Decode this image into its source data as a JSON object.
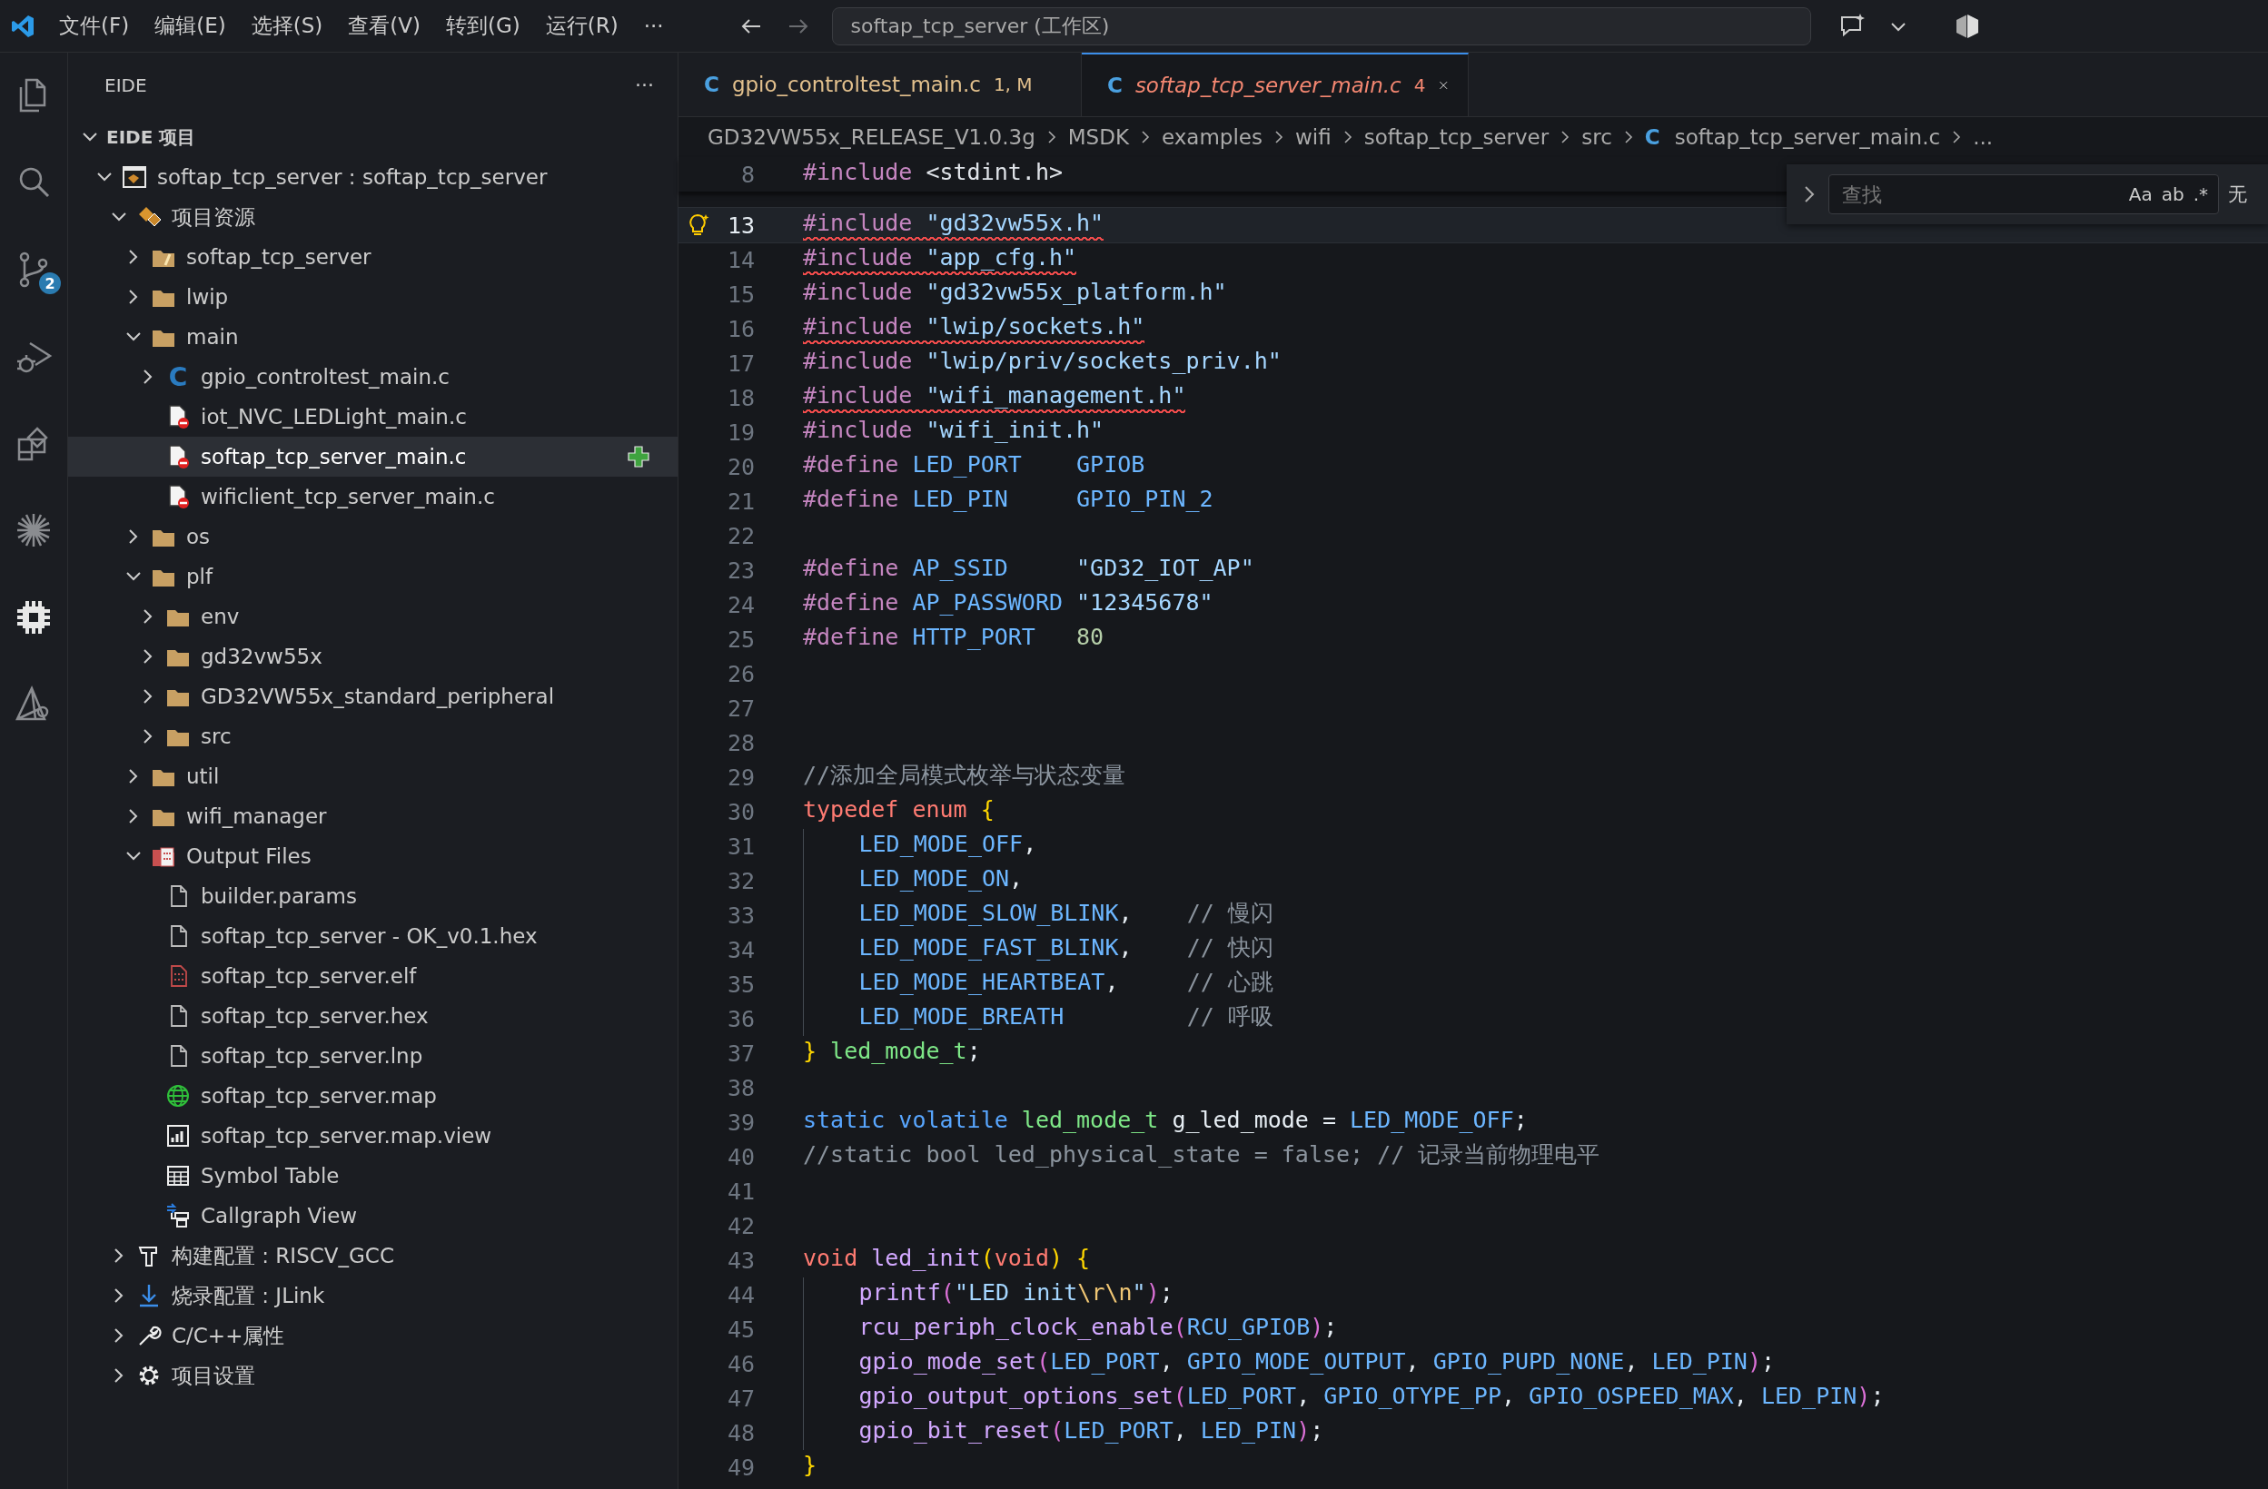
{
  "menubar": {
    "menus": [
      "文件(F)",
      "编辑(E)",
      "选择(S)",
      "查看(V)",
      "转到(G)",
      "运行(R)"
    ],
    "overflow": "···",
    "command_center": "softap_tcp_server (工作区)"
  },
  "activity_bar": [
    {
      "kind": "files",
      "selected": false
    },
    {
      "kind": "search",
      "selected": false
    },
    {
      "kind": "source-control",
      "selected": false,
      "badge": "2"
    },
    {
      "kind": "run-debug",
      "selected": false
    },
    {
      "kind": "extensions",
      "selected": false
    },
    {
      "kind": "starburst",
      "selected": false
    },
    {
      "kind": "chip",
      "selected": true
    },
    {
      "kind": "triangle-tool",
      "selected": false
    }
  ],
  "sidebar": {
    "title": "EIDE",
    "more": "···",
    "tree": [
      {
        "label": "EIDE 项目",
        "kind": "section",
        "expanded": true,
        "selected": false,
        "children": [
          {
            "label": "softap_tcp_server : softap_tcp_server",
            "kind": "project",
            "expanded": true,
            "selected": false,
            "children": [
              {
                "label": "项目资源",
                "kind": "resources",
                "expanded": true,
                "selected": false,
                "children": [
                  {
                    "label": "softap_tcp_server",
                    "kind": "folder-link",
                    "expanded": false,
                    "selected": false
                  },
                  {
                    "label": "lwip",
                    "kind": "folder",
                    "expanded": false,
                    "selected": false
                  },
                  {
                    "label": "main",
                    "kind": "folder",
                    "expanded": true,
                    "selected": false,
                    "children": [
                      {
                        "label": "gpio_controltest_main.c",
                        "kind": "c-file",
                        "icon_text": "C",
                        "expanded": false,
                        "selected": false
                      },
                      {
                        "label": "iot_NVC_LEDLight_main.c",
                        "kind": "excluded-file",
                        "selected": false
                      },
                      {
                        "label": "softap_tcp_server_main.c",
                        "kind": "excluded-file",
                        "selected": true
                      },
                      {
                        "label": "wificlient_tcp_server_main.c",
                        "kind": "excluded-file",
                        "selected": false
                      }
                    ]
                  },
                  {
                    "label": "os",
                    "kind": "folder",
                    "expanded": false,
                    "selected": false
                  },
                  {
                    "label": "plf",
                    "kind": "folder",
                    "expanded": true,
                    "selected": false,
                    "children": [
                      {
                        "label": "env",
                        "kind": "folder",
                        "expanded": false,
                        "selected": false
                      },
                      {
                        "label": "gd32vw55x",
                        "kind": "folder",
                        "expanded": false,
                        "selected": false
                      },
                      {
                        "label": "GD32VW55x_standard_peripheral",
                        "kind": "folder",
                        "expanded": false,
                        "selected": false
                      },
                      {
                        "label": "src",
                        "kind": "folder",
                        "expanded": false,
                        "selected": false
                      }
                    ]
                  },
                  {
                    "label": "util",
                    "kind": "folder",
                    "expanded": false,
                    "selected": false
                  },
                  {
                    "label": "wifi_manager",
                    "kind": "folder",
                    "expanded": false,
                    "selected": false
                  },
                  {
                    "label": "Output Files",
                    "kind": "binary-folder",
                    "expanded": true,
                    "selected": false,
                    "children": [
                      {
                        "label": "builder.params",
                        "kind": "file",
                        "selected": false
                      },
                      {
                        "label": "softap_tcp_server - OK_v0.1.hex",
                        "kind": "file",
                        "selected": false
                      },
                      {
                        "label": "softap_tcp_server.elf",
                        "kind": "binary-file",
                        "selected": false
                      },
                      {
                        "label": "softap_tcp_server.hex",
                        "kind": "file",
                        "selected": false
                      },
                      {
                        "label": "softap_tcp_server.lnp",
                        "kind": "file",
                        "selected": false
                      },
                      {
                        "label": "softap_tcp_server.map",
                        "kind": "globe",
                        "selected": false
                      },
                      {
                        "label": "softap_tcp_server.map.view",
                        "kind": "chart",
                        "selected": false
                      },
                      {
                        "label": "Symbol Table",
                        "kind": "table",
                        "selected": false
                      },
                      {
                        "label": "Callgraph View",
                        "kind": "callgraph",
                        "selected": false
                      }
                    ]
                  }
                ]
              },
              {
                "label": "构建配置 : RISCV_GCC",
                "kind": "hammer",
                "expanded": false,
                "selected": false
              },
              {
                "label": "烧录配置 : JLink",
                "kind": "download",
                "expanded": false,
                "selected": false
              },
              {
                "label": "C/C++属性",
                "kind": "wrench",
                "expanded": false,
                "selected": false
              },
              {
                "label": "项目设置",
                "kind": "gear",
                "expanded": false,
                "selected": false
              }
            ]
          }
        ]
      }
    ]
  },
  "tabs": [
    {
      "icon_text": "C",
      "label": "gpio_controltest_main.c",
      "status": "1, M",
      "color": "#e2c08d",
      "preview": false,
      "selected": false
    },
    {
      "icon_text": "C",
      "label": "softap_tcp_server_main.c",
      "status": "4",
      "color": "#f48771",
      "preview": true,
      "selected": true
    }
  ],
  "breadcrumbs": [
    {
      "label": "GD32VW55x_RELEASE_V1.0.3g"
    },
    {
      "label": "MSDK"
    },
    {
      "label": "examples"
    },
    {
      "label": "wifi"
    },
    {
      "label": "softap_tcp_server"
    },
    {
      "label": "src"
    },
    {
      "label": "softap_tcp_server_main.c",
      "icon_text": "C"
    },
    {
      "label": "..."
    }
  ],
  "find_widget": {
    "placeholder": "查找",
    "options": [
      {
        "label": "Aa",
        "selected": false
      },
      {
        "label": "ab",
        "selected": false
      },
      {
        "label": ".*",
        "selected": false
      }
    ],
    "result": "无"
  },
  "sticky_line": {
    "n": "8",
    "tokens": [
      {
        "t": "#include ",
        "kind": "pp"
      },
      {
        "t": "<stdint.h>",
        "kind": "hdr"
      }
    ]
  },
  "lines": [
    {
      "n": "13",
      "current": true,
      "squiggle": true,
      "tokens": [
        {
          "t": "#include ",
          "kind": "pp"
        },
        {
          "t": "\"gd32vw55x.h\"",
          "kind": "str"
        }
      ]
    },
    {
      "n": "14",
      "current": false,
      "squiggle": true,
      "tokens": [
        {
          "t": "#include ",
          "kind": "pp"
        },
        {
          "t": "\"app_cfg.h\"",
          "kind": "str"
        }
      ]
    },
    {
      "n": "15",
      "current": false,
      "squiggle": false,
      "tokens": [
        {
          "t": "#include ",
          "kind": "pp"
        },
        {
          "t": "\"gd32vw55x_platform.h\"",
          "kind": "str"
        }
      ]
    },
    {
      "n": "16",
      "current": false,
      "squiggle": true,
      "tokens": [
        {
          "t": "#include ",
          "kind": "pp"
        },
        {
          "t": "\"lwip/sockets.h\"",
          "kind": "str"
        }
      ]
    },
    {
      "n": "17",
      "current": false,
      "squiggle": false,
      "tokens": [
        {
          "t": "#include ",
          "kind": "pp"
        },
        {
          "t": "\"lwip/priv/sockets_priv.h\"",
          "kind": "str"
        }
      ]
    },
    {
      "n": "18",
      "current": false,
      "squiggle": true,
      "tokens": [
        {
          "t": "#include ",
          "kind": "pp"
        },
        {
          "t": "\"wifi_management.h\"",
          "kind": "str"
        }
      ]
    },
    {
      "n": "19",
      "current": false,
      "squiggle": false,
      "tokens": [
        {
          "t": "#include ",
          "kind": "pp"
        },
        {
          "t": "\"wifi_init.h\"",
          "kind": "str"
        }
      ]
    },
    {
      "n": "20",
      "current": false,
      "squiggle": false,
      "tokens": [
        {
          "t": "#define ",
          "kind": "pp"
        },
        {
          "t": "LED_PORT    GPIOB",
          "kind": "mac"
        }
      ]
    },
    {
      "n": "21",
      "current": false,
      "squiggle": false,
      "tokens": [
        {
          "t": "#define ",
          "kind": "pp"
        },
        {
          "t": "LED_PIN     GPIO_PIN_2",
          "kind": "mac"
        }
      ]
    },
    {
      "n": "22",
      "current": false
    },
    {
      "n": "23",
      "current": false,
      "squiggle": false,
      "tokens": [
        {
          "t": "#define ",
          "kind": "pp"
        },
        {
          "t": "AP_SSID     ",
          "kind": "mac"
        },
        {
          "t": "\"GD32_IOT_AP\"",
          "kind": "str"
        }
      ]
    },
    {
      "n": "24",
      "current": false,
      "squiggle": false,
      "tokens": [
        {
          "t": "#define ",
          "kind": "pp"
        },
        {
          "t": "AP_PASSWORD ",
          "kind": "mac"
        },
        {
          "t": "\"12345678\"",
          "kind": "str"
        }
      ]
    },
    {
      "n": "25",
      "current": false,
      "squiggle": false,
      "tokens": [
        {
          "t": "#define ",
          "kind": "pp"
        },
        {
          "t": "HTTP_PORT   ",
          "kind": "mac"
        },
        {
          "t": "80",
          "kind": "num"
        }
      ]
    },
    {
      "n": "26",
      "current": false
    },
    {
      "n": "27",
      "current": false
    },
    {
      "n": "28",
      "current": false
    },
    {
      "n": "29",
      "current": false,
      "squiggle": false,
      "tokens": [
        {
          "t": "//添加全局模式枚举与状态变量",
          "kind": "cmt"
        }
      ]
    },
    {
      "n": "30",
      "current": false,
      "squiggle": false,
      "tokens": [
        {
          "t": "typedef enum ",
          "kind": "kw"
        },
        {
          "t": "{",
          "kind": "p1"
        }
      ]
    },
    {
      "n": "31",
      "current": false,
      "squiggle": false,
      "indented": true,
      "tokens": [
        {
          "t": "LED_MODE_OFF",
          "kind": "mac"
        },
        {
          "t": ",",
          "kind": "plain"
        }
      ]
    },
    {
      "n": "32",
      "current": false,
      "squiggle": false,
      "indented": true,
      "tokens": [
        {
          "t": "LED_MODE_ON",
          "kind": "mac"
        },
        {
          "t": ",",
          "kind": "plain"
        }
      ]
    },
    {
      "n": "33",
      "current": false,
      "squiggle": false,
      "indented": true,
      "tokens": [
        {
          "t": "LED_MODE_SLOW_BLINK",
          "kind": "mac"
        },
        {
          "t": ",    ",
          "kind": "plain"
        },
        {
          "t": "// 慢闪",
          "kind": "cmt"
        }
      ]
    },
    {
      "n": "34",
      "current": false,
      "squiggle": false,
      "indented": true,
      "tokens": [
        {
          "t": "LED_MODE_FAST_BLINK",
          "kind": "mac"
        },
        {
          "t": ",    ",
          "kind": "plain"
        },
        {
          "t": "// 快闪",
          "kind": "cmt"
        }
      ]
    },
    {
      "n": "35",
      "current": false,
      "squiggle": false,
      "indented": true,
      "tokens": [
        {
          "t": "LED_MODE_HEARTBEAT",
          "kind": "mac"
        },
        {
          "t": ",     ",
          "kind": "plain"
        },
        {
          "t": "// 心跳",
          "kind": "cmt"
        }
      ]
    },
    {
      "n": "36",
      "current": false,
      "squiggle": false,
      "indented": true,
      "tokens": [
        {
          "t": "LED_MODE_BREATH         ",
          "kind": "mac"
        },
        {
          "t": "// 呼吸",
          "kind": "cmt"
        }
      ]
    },
    {
      "n": "37",
      "current": false,
      "squiggle": false,
      "tokens": [
        {
          "t": "}",
          "kind": "p1"
        },
        {
          "t": " led_mode_t",
          "kind": "type"
        },
        {
          "t": ";",
          "kind": "plain"
        }
      ]
    },
    {
      "n": "38",
      "current": false
    },
    {
      "n": "39",
      "current": false,
      "squiggle": false,
      "tokens": [
        {
          "t": "static volatile ",
          "kind": "kw2"
        },
        {
          "t": "led_mode_t",
          "kind": "type"
        },
        {
          "t": " g_led_mode = ",
          "kind": "plain"
        },
        {
          "t": "LED_MODE_OFF",
          "kind": "mac"
        },
        {
          "t": ";",
          "kind": "plain"
        }
      ]
    },
    {
      "n": "40",
      "current": false,
      "squiggle": false,
      "tokens": [
        {
          "t": "//static bool led_physical_state = false; // 记录当前物理电平",
          "kind": "cmt"
        }
      ]
    },
    {
      "n": "41",
      "current": false
    },
    {
      "n": "42",
      "current": false
    },
    {
      "n": "43",
      "current": false,
      "squiggle": false,
      "tokens": [
        {
          "t": "void ",
          "kind": "kw"
        },
        {
          "t": "led_init",
          "kind": "fn"
        },
        {
          "t": "(",
          "kind": "p1"
        },
        {
          "t": "void",
          "kind": "kw"
        },
        {
          "t": ")",
          "kind": "p1"
        },
        {
          "t": " {",
          "kind": "p1"
        }
      ]
    },
    {
      "n": "44",
      "current": false,
      "squiggle": false,
      "indented": true,
      "tokens": [
        {
          "t": "printf",
          "kind": "fn"
        },
        {
          "t": "(",
          "kind": "p2"
        },
        {
          "t": "\"LED init",
          "kind": "str"
        },
        {
          "t": "\\r\\n",
          "kind": "esc"
        },
        {
          "t": "\"",
          "kind": "str"
        },
        {
          "t": ")",
          "kind": "p2"
        },
        {
          "t": ";",
          "kind": "plain"
        }
      ]
    },
    {
      "n": "45",
      "current": false,
      "squiggle": false,
      "indented": true,
      "tokens": [
        {
          "t": "rcu_periph_clock_enable",
          "kind": "fn"
        },
        {
          "t": "(",
          "kind": "p2"
        },
        {
          "t": "RCU_GPIOB",
          "kind": "mac"
        },
        {
          "t": ")",
          "kind": "p2"
        },
        {
          "t": ";",
          "kind": "plain"
        }
      ]
    },
    {
      "n": "46",
      "current": false,
      "squiggle": false,
      "indented": true,
      "tokens": [
        {
          "t": "gpio_mode_set",
          "kind": "fn"
        },
        {
          "t": "(",
          "kind": "p2"
        },
        {
          "t": "LED_PORT",
          "kind": "mac"
        },
        {
          "t": ", ",
          "kind": "plain"
        },
        {
          "t": "GPIO_MODE_OUTPUT",
          "kind": "mac"
        },
        {
          "t": ", ",
          "kind": "plain"
        },
        {
          "t": "GPIO_PUPD_NONE",
          "kind": "mac"
        },
        {
          "t": ", ",
          "kind": "plain"
        },
        {
          "t": "LED_PIN",
          "kind": "mac"
        },
        {
          "t": ")",
          "kind": "p2"
        },
        {
          "t": ";",
          "kind": "plain"
        }
      ]
    },
    {
      "n": "47",
      "current": false,
      "squiggle": false,
      "indented": true,
      "tokens": [
        {
          "t": "gpio_output_options_set",
          "kind": "fn"
        },
        {
          "t": "(",
          "kind": "p2"
        },
        {
          "t": "LED_PORT",
          "kind": "mac"
        },
        {
          "t": ", ",
          "kind": "plain"
        },
        {
          "t": "GPIO_OTYPE_PP",
          "kind": "mac"
        },
        {
          "t": ", ",
          "kind": "plain"
        },
        {
          "t": "GPIO_OSPEED_MAX",
          "kind": "mac"
        },
        {
          "t": ", ",
          "kind": "plain"
        },
        {
          "t": "LED_PIN",
          "kind": "mac"
        },
        {
          "t": ")",
          "kind": "p2"
        },
        {
          "t": ";",
          "kind": "plain"
        }
      ]
    },
    {
      "n": "48",
      "current": false,
      "squiggle": false,
      "indented": true,
      "tokens": [
        {
          "t": "gpio_bit_reset",
          "kind": "fn"
        },
        {
          "t": "(",
          "kind": "p2"
        },
        {
          "t": "LED_PORT",
          "kind": "mac"
        },
        {
          "t": ", ",
          "kind": "plain"
        },
        {
          "t": "LED_PIN",
          "kind": "mac"
        },
        {
          "t": ")",
          "kind": "p2"
        },
        {
          "t": ";",
          "kind": "plain"
        }
      ]
    },
    {
      "n": "49",
      "current": false,
      "squiggle": false,
      "tokens": [
        {
          "t": "}",
          "kind": "p1"
        }
      ]
    }
  ]
}
